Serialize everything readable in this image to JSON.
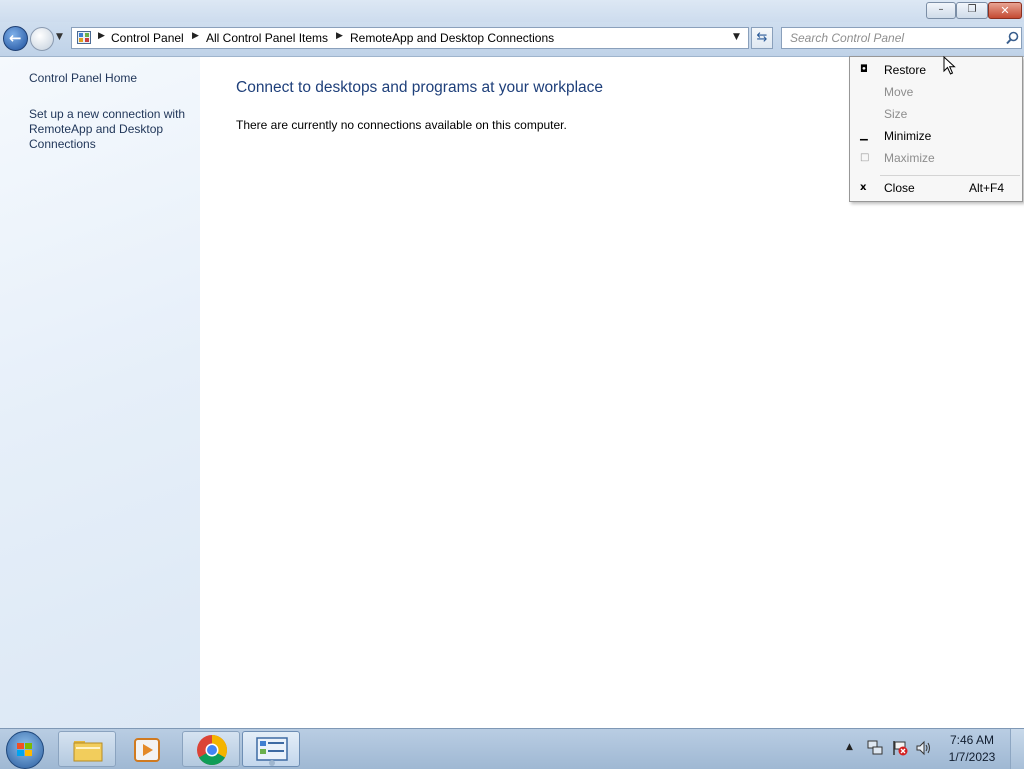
{
  "window": {
    "caption_buttons": {
      "minimize": "–",
      "restore": "❐",
      "close": "✕"
    }
  },
  "navigation": {
    "breadcrumbs": [
      "Control Panel",
      "All Control Panel Items",
      "RemoteApp and Desktop Connections"
    ],
    "search_placeholder": "Search Control Panel"
  },
  "left_pane": {
    "links": [
      "Control Panel Home",
      "Set up a new connection with RemoteApp and Desktop Connections"
    ]
  },
  "main": {
    "title": "Connect to desktops and programs at your workplace",
    "description": "There are currently no connections available on this computer."
  },
  "system_menu": {
    "items": [
      {
        "label": "Restore",
        "enabled": true,
        "icon": "restore-icon"
      },
      {
        "label": "Move",
        "enabled": false,
        "icon": ""
      },
      {
        "label": "Size",
        "enabled": false,
        "icon": ""
      },
      {
        "label": "Minimize",
        "enabled": true,
        "icon": "minimize-icon"
      },
      {
        "label": "Maximize",
        "enabled": false,
        "icon": "maximize-icon"
      },
      {
        "label": "Close",
        "enabled": true,
        "icon": "close-icon",
        "shortcut": "Alt+F4"
      }
    ]
  },
  "taskbar": {
    "pinned": [
      "windows-explorer",
      "windows-media-player",
      "google-chrome",
      "control-panel"
    ],
    "clock": {
      "time": "7:46 AM",
      "date": "1/7/2023"
    }
  },
  "colors": {
    "title_text": "#1e3f7a",
    "link_text": "#1f3558",
    "close_button": "#c44a32"
  }
}
